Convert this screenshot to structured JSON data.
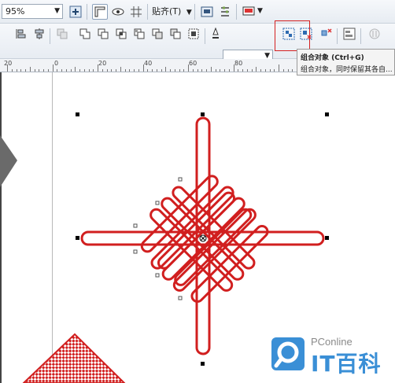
{
  "toolbar_top": {
    "zoom_value": "95%",
    "snap_label": "贴齐(T)"
  },
  "toolbar_bottom": {
    "outline_width_value": ""
  },
  "tooltip": {
    "title": "组合对象 (Ctrl+G)",
    "description": "组合对象，同时保留其各自..."
  },
  "ruler": {
    "labels": [
      "20",
      "0",
      "20",
      "40",
      "60",
      "80"
    ]
  },
  "watermark": {
    "brand": "PConline",
    "name": "IT百科"
  },
  "colors": {
    "knot_red": "#d11f1f",
    "highlight_red": "#d42020",
    "brand_blue": "#3a8fd6"
  }
}
